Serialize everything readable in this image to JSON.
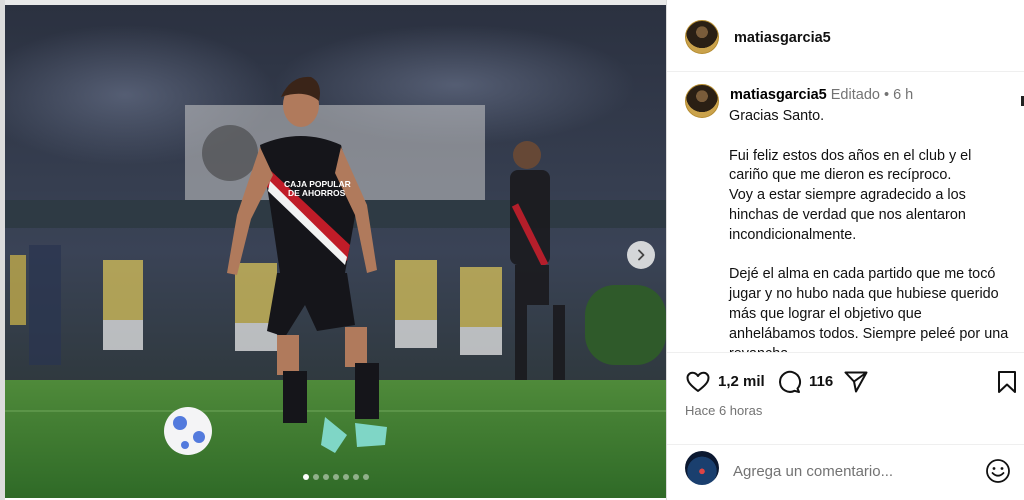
{
  "post": {
    "username": "matiasgarcia5",
    "edited_label": "Editado",
    "separator": "•",
    "time_short": "6 h",
    "caption": "Gracias Santo.\n\nFui feliz estos dos años en el club y el cariño que me dieron es recíproco.\nVoy a estar siempre agradecido a los hinchas de verdad que nos alentaron incondicionalmente.\n\nDejé el alma en cada partido que me tocó jugar y no hubo nada que hubiese querido más que lograr el objetivo que anhelábamos todos. Siempre peleé por una revancha",
    "likes": "1,2 mil",
    "comments_count": "116",
    "time_ago": "Hace 6 horas"
  },
  "media": {
    "jersey_sponsor": "CAJA POPULAR DE AHORROS",
    "carousel": {
      "total": 7,
      "active_index": 0
    }
  },
  "comment_box": {
    "placeholder": "Agrega un comentario..."
  },
  "icons": {
    "like": "heart-icon",
    "comment": "comment-bubble-icon",
    "share": "send-icon",
    "save": "bookmark-icon",
    "emoji": "emoji-icon",
    "next": "chevron-right-icon"
  },
  "colors": {
    "text_muted": "#737373",
    "divider": "#efefef"
  }
}
